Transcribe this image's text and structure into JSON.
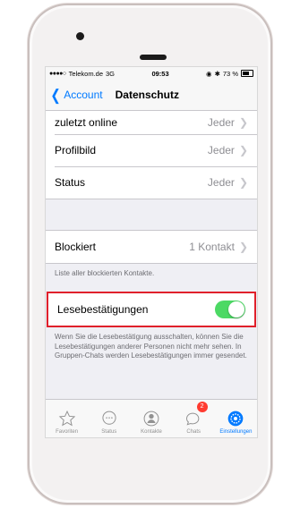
{
  "status_bar": {
    "signal": "●●●●○",
    "carrier": "Telekom.de",
    "network": "3G",
    "time": "09:53",
    "battery": "73 %"
  },
  "nav": {
    "back_label": "Account",
    "title": "Datenschutz"
  },
  "privacy_rows": [
    {
      "label": "zuletzt online",
      "value": "Jeder"
    },
    {
      "label": "Profilbild",
      "value": "Jeder"
    },
    {
      "label": "Status",
      "value": "Jeder"
    }
  ],
  "blocked": {
    "label": "Blockiert",
    "value": "1 Kontakt",
    "footnote": "Liste aller blockierten Kontakte."
  },
  "read_receipts": {
    "label": "Lesebestätigungen",
    "enabled": true,
    "footnote": "Wenn Sie die Lesebestätigung ausschalten, können Sie die Lesebestätigungen anderer Personen nicht mehr sehen. In Gruppen-Chats werden Lesebestätigungen immer gesendet."
  },
  "tabs": [
    {
      "label": "Favoriten",
      "icon": "star-icon"
    },
    {
      "label": "Status",
      "icon": "speech-bubble-icon"
    },
    {
      "label": "Kontakte",
      "icon": "person-icon"
    },
    {
      "label": "Chats",
      "icon": "chats-icon",
      "badge": "2"
    },
    {
      "label": "Einstellungen",
      "icon": "gear-icon",
      "active": true
    }
  ],
  "colors": {
    "accent": "#007aff",
    "toggle_on": "#4cd964",
    "highlight": "#e0202b",
    "badge": "#ff3b30"
  }
}
